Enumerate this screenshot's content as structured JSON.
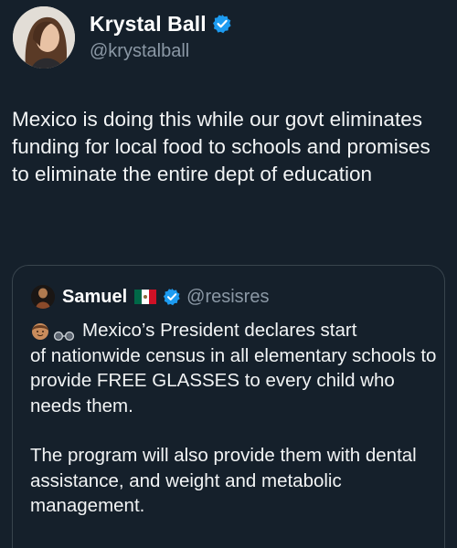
{
  "author": {
    "display_name": "Krystal Ball",
    "handle": "@krystalball",
    "verified_icon": "verified-badge-icon"
  },
  "tweet": {
    "text": "Mexico is doing this while our govt eliminates funding for local food to schools and promises to eliminate the entire dept of education"
  },
  "quoted_tweet": {
    "display_name": "Samuel",
    "flag_icon": "mexico-flag-icon",
    "verified_icon": "verified-badge-icon",
    "handle": "@resisres",
    "emoji_icons": [
      "face-emoji-icon",
      "glasses-emoji-icon"
    ],
    "line1": "Mexico’s President declares start",
    "line1_rest": "of nationwide census in all elementary schools to provide FREE GLASSES to every child who needs them.",
    "paragraph2": "The program will also provide them with dental assistance, and weight and metabolic management."
  },
  "colors": {
    "background": "#15202b",
    "text": "#f2f4f5",
    "secondary": "#8b98a5",
    "verified_blue": "#1d9bf0",
    "border": "#38444d"
  }
}
